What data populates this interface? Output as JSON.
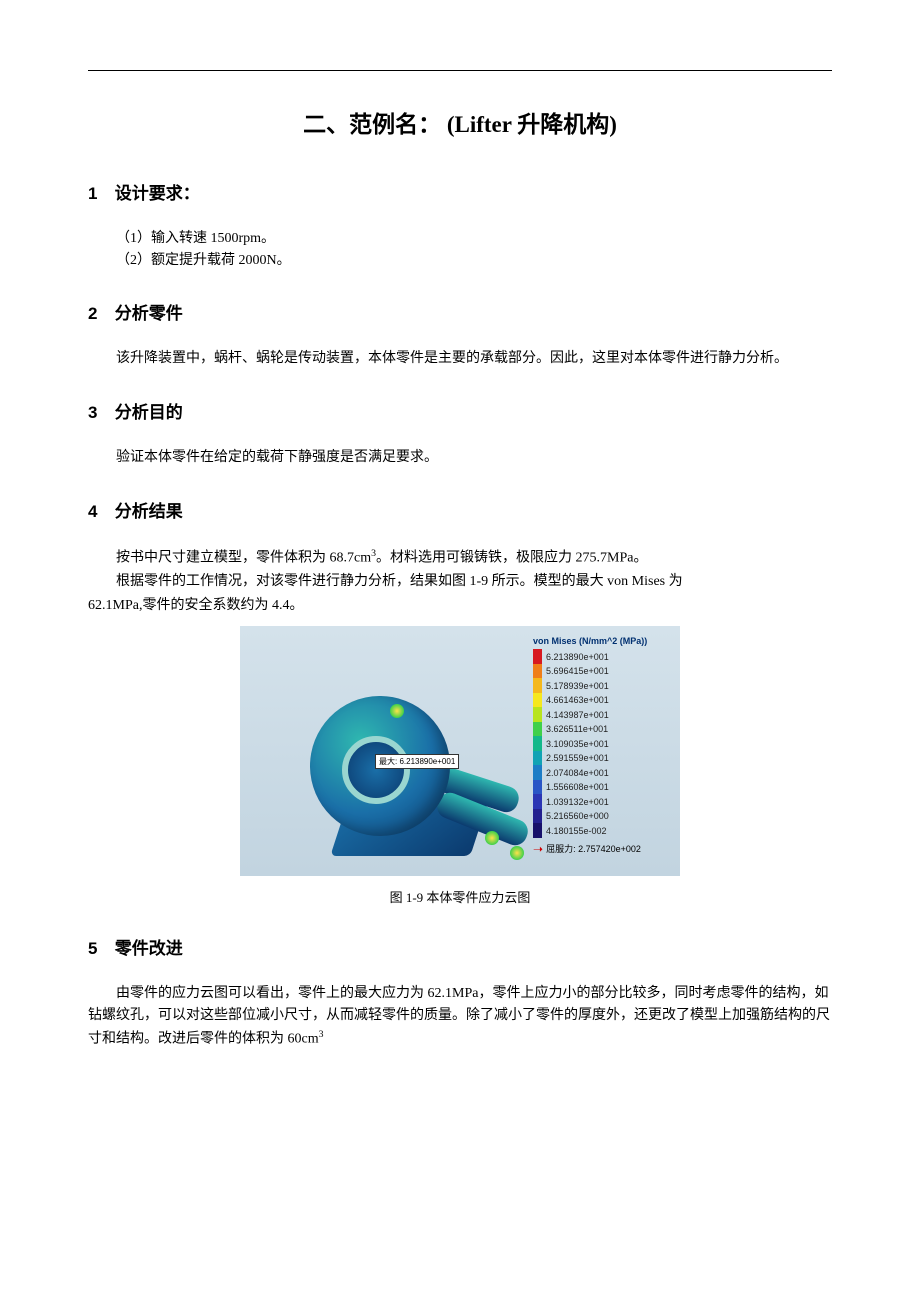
{
  "title": "二、范例名：  (Lifter 升降机构)",
  "sections": {
    "s1": {
      "num": "1",
      "heading": "设计要求：",
      "lines": [
        "（1）输入转速 1500rpm。",
        "（2）额定提升载荷 2000N。"
      ]
    },
    "s2": {
      "num": "2",
      "heading": "分析零件",
      "para": "该升降装置中，蜗杆、蜗轮是传动装置，本体零件是主要的承载部分。因此，这里对本体零件进行静力分析。"
    },
    "s3": {
      "num": "3",
      "heading": "分析目的",
      "para": "验证本体零件在给定的载荷下静强度是否满足要求。"
    },
    "s4": {
      "num": "4",
      "heading": "分析结果",
      "p1_a": "按书中尺寸建立模型，零件体积为 68.7cm",
      "p1_sup": "3",
      "p1_b": "。材料选用可锻铸铁，极限应力 275.7MPa。",
      "p2": "根据零件的工作情况，对该零件进行静力分析，结果如图 1-9 所示。模型的最大 von Mises 为",
      "p3": "62.1MPa,零件的安全系数约为 4.4。"
    },
    "s5": {
      "num": "5",
      "heading": "零件改进",
      "p1": "由零件的应力云图可以看出，零件上的最大应力为 62.1MPa，零件上应力小的部分比较多，同时考虑零件的结构，如钻螺纹孔，可以对这些部位减小尺寸，从而减轻零件的质量。除了减小了零件的厚度外，还更改了模型上加强筋结构的尺寸和结构。改进后零件的体积为 60cm",
      "p1_sup": "3"
    }
  },
  "figure": {
    "callout": "最大: 6.213890e+001",
    "legend_title": "von Mises (N/mm^2 (MPa))",
    "levels": [
      {
        "color": "#d71920",
        "label": "6.213890e+001"
      },
      {
        "color": "#ef7e1a",
        "label": "5.696415e+001"
      },
      {
        "color": "#f5b81c",
        "label": "5.178939e+001"
      },
      {
        "color": "#f6e81e",
        "label": "4.661463e+001"
      },
      {
        "color": "#b8e41e",
        "label": "4.143987e+001"
      },
      {
        "color": "#3fd04a",
        "label": "3.626511e+001"
      },
      {
        "color": "#13b88a",
        "label": "3.109035e+001"
      },
      {
        "color": "#11a3b4",
        "label": "2.591559e+001"
      },
      {
        "color": "#1c7dc6",
        "label": "2.074084e+001"
      },
      {
        "color": "#2a55c6",
        "label": "1.556608e+001"
      },
      {
        "color": "#2b35b4",
        "label": "1.039132e+001"
      },
      {
        "color": "#23208f",
        "label": "5.216560e+000"
      },
      {
        "color": "#17106a",
        "label": "4.180155e-002"
      }
    ],
    "yield_label": "屈服力: 2.757420e+002",
    "caption": "图 1-9   本体零件应力云图"
  }
}
